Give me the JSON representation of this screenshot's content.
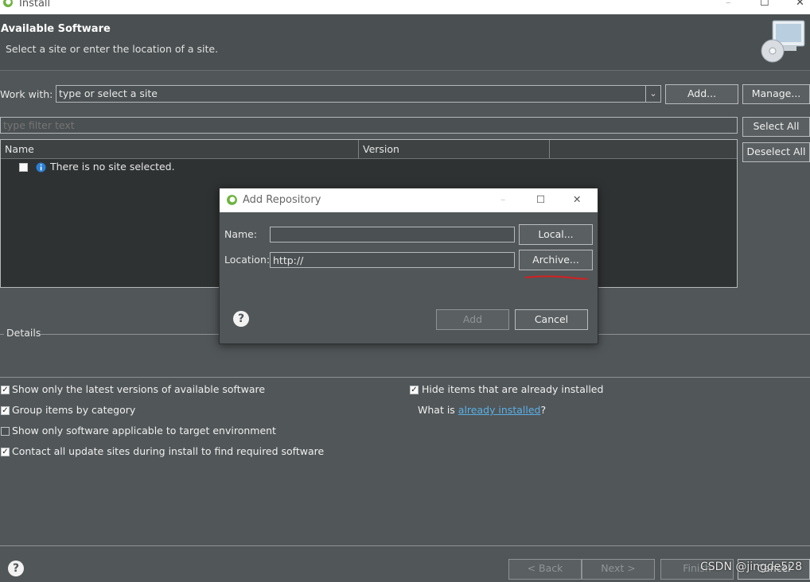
{
  "window": {
    "title": "Install",
    "controls": {
      "minimize": "–",
      "maximize": "☐",
      "close": "✕"
    }
  },
  "header": {
    "title": "Available Software",
    "subtitle": "Select a site or enter the location of a site."
  },
  "work_with": {
    "label": "Work with:",
    "value": "type or select a site",
    "add_label": "Add...",
    "manage_label": "Manage..."
  },
  "filter": {
    "placeholder": "type filter text",
    "select_all_label": "Select All",
    "deselect_all_label": "Deselect All"
  },
  "table": {
    "columns": [
      "Name",
      "Version",
      ""
    ],
    "rows": [
      {
        "checked": false,
        "icon": "info-icon",
        "name": "There is no site selected."
      }
    ]
  },
  "details": {
    "label": "Details"
  },
  "options": {
    "latest_versions": {
      "label": "Show only the latest versions of available software",
      "checked": true
    },
    "group_by_category": {
      "label": "Group items by category",
      "checked": true
    },
    "applicable_only": {
      "label": "Show only software applicable to target environment",
      "checked": false
    },
    "contact_sites": {
      "label": "Contact all update sites during install to find required software",
      "checked": true
    },
    "hide_installed": {
      "label": "Hide items that are already installed",
      "checked": true
    },
    "what_is": {
      "prefix": "What is ",
      "link": "already installed",
      "suffix": "?"
    }
  },
  "footer": {
    "back_label": "< Back",
    "next_label": "Next >",
    "finish_label": "Finish",
    "cancel_label": "Cancel"
  },
  "dialog": {
    "title": "Add Repository",
    "name_label": "Name:",
    "name_value": "",
    "location_label": "Location:",
    "location_value": "http://",
    "local_label": "Local...",
    "archive_label": "Archive...",
    "add_label": "Add",
    "cancel_label": "Cancel"
  },
  "watermark": "CSDN @jingde528",
  "colors": {
    "background": "#515658",
    "link": "#5ab0e6",
    "annotation": "#d42020"
  }
}
